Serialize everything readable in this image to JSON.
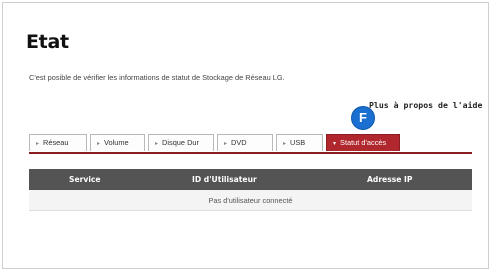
{
  "page": {
    "title": "Etat",
    "description": "C'est posible de vérifier les informations de statut de Stockage de Réseau LG.",
    "help_link": "Plus à propos de l'aide",
    "badge": "F"
  },
  "tabs": [
    {
      "label": "Réseau",
      "active": false
    },
    {
      "label": "Volume",
      "active": false
    },
    {
      "label": "Disque Dur",
      "active": false
    },
    {
      "label": "DVD",
      "active": false
    },
    {
      "label": "USB",
      "active": false
    },
    {
      "label": "Statut d'accès",
      "active": true
    }
  ],
  "table": {
    "columns": [
      "Service",
      "ID d'Utilisateur",
      "Adresse IP"
    ],
    "empty_message": "Pas d'utilisateur connecté"
  },
  "colors": {
    "active_tab": "#b0272d",
    "table_header": "#545454",
    "badge": "#1a6fd0"
  }
}
